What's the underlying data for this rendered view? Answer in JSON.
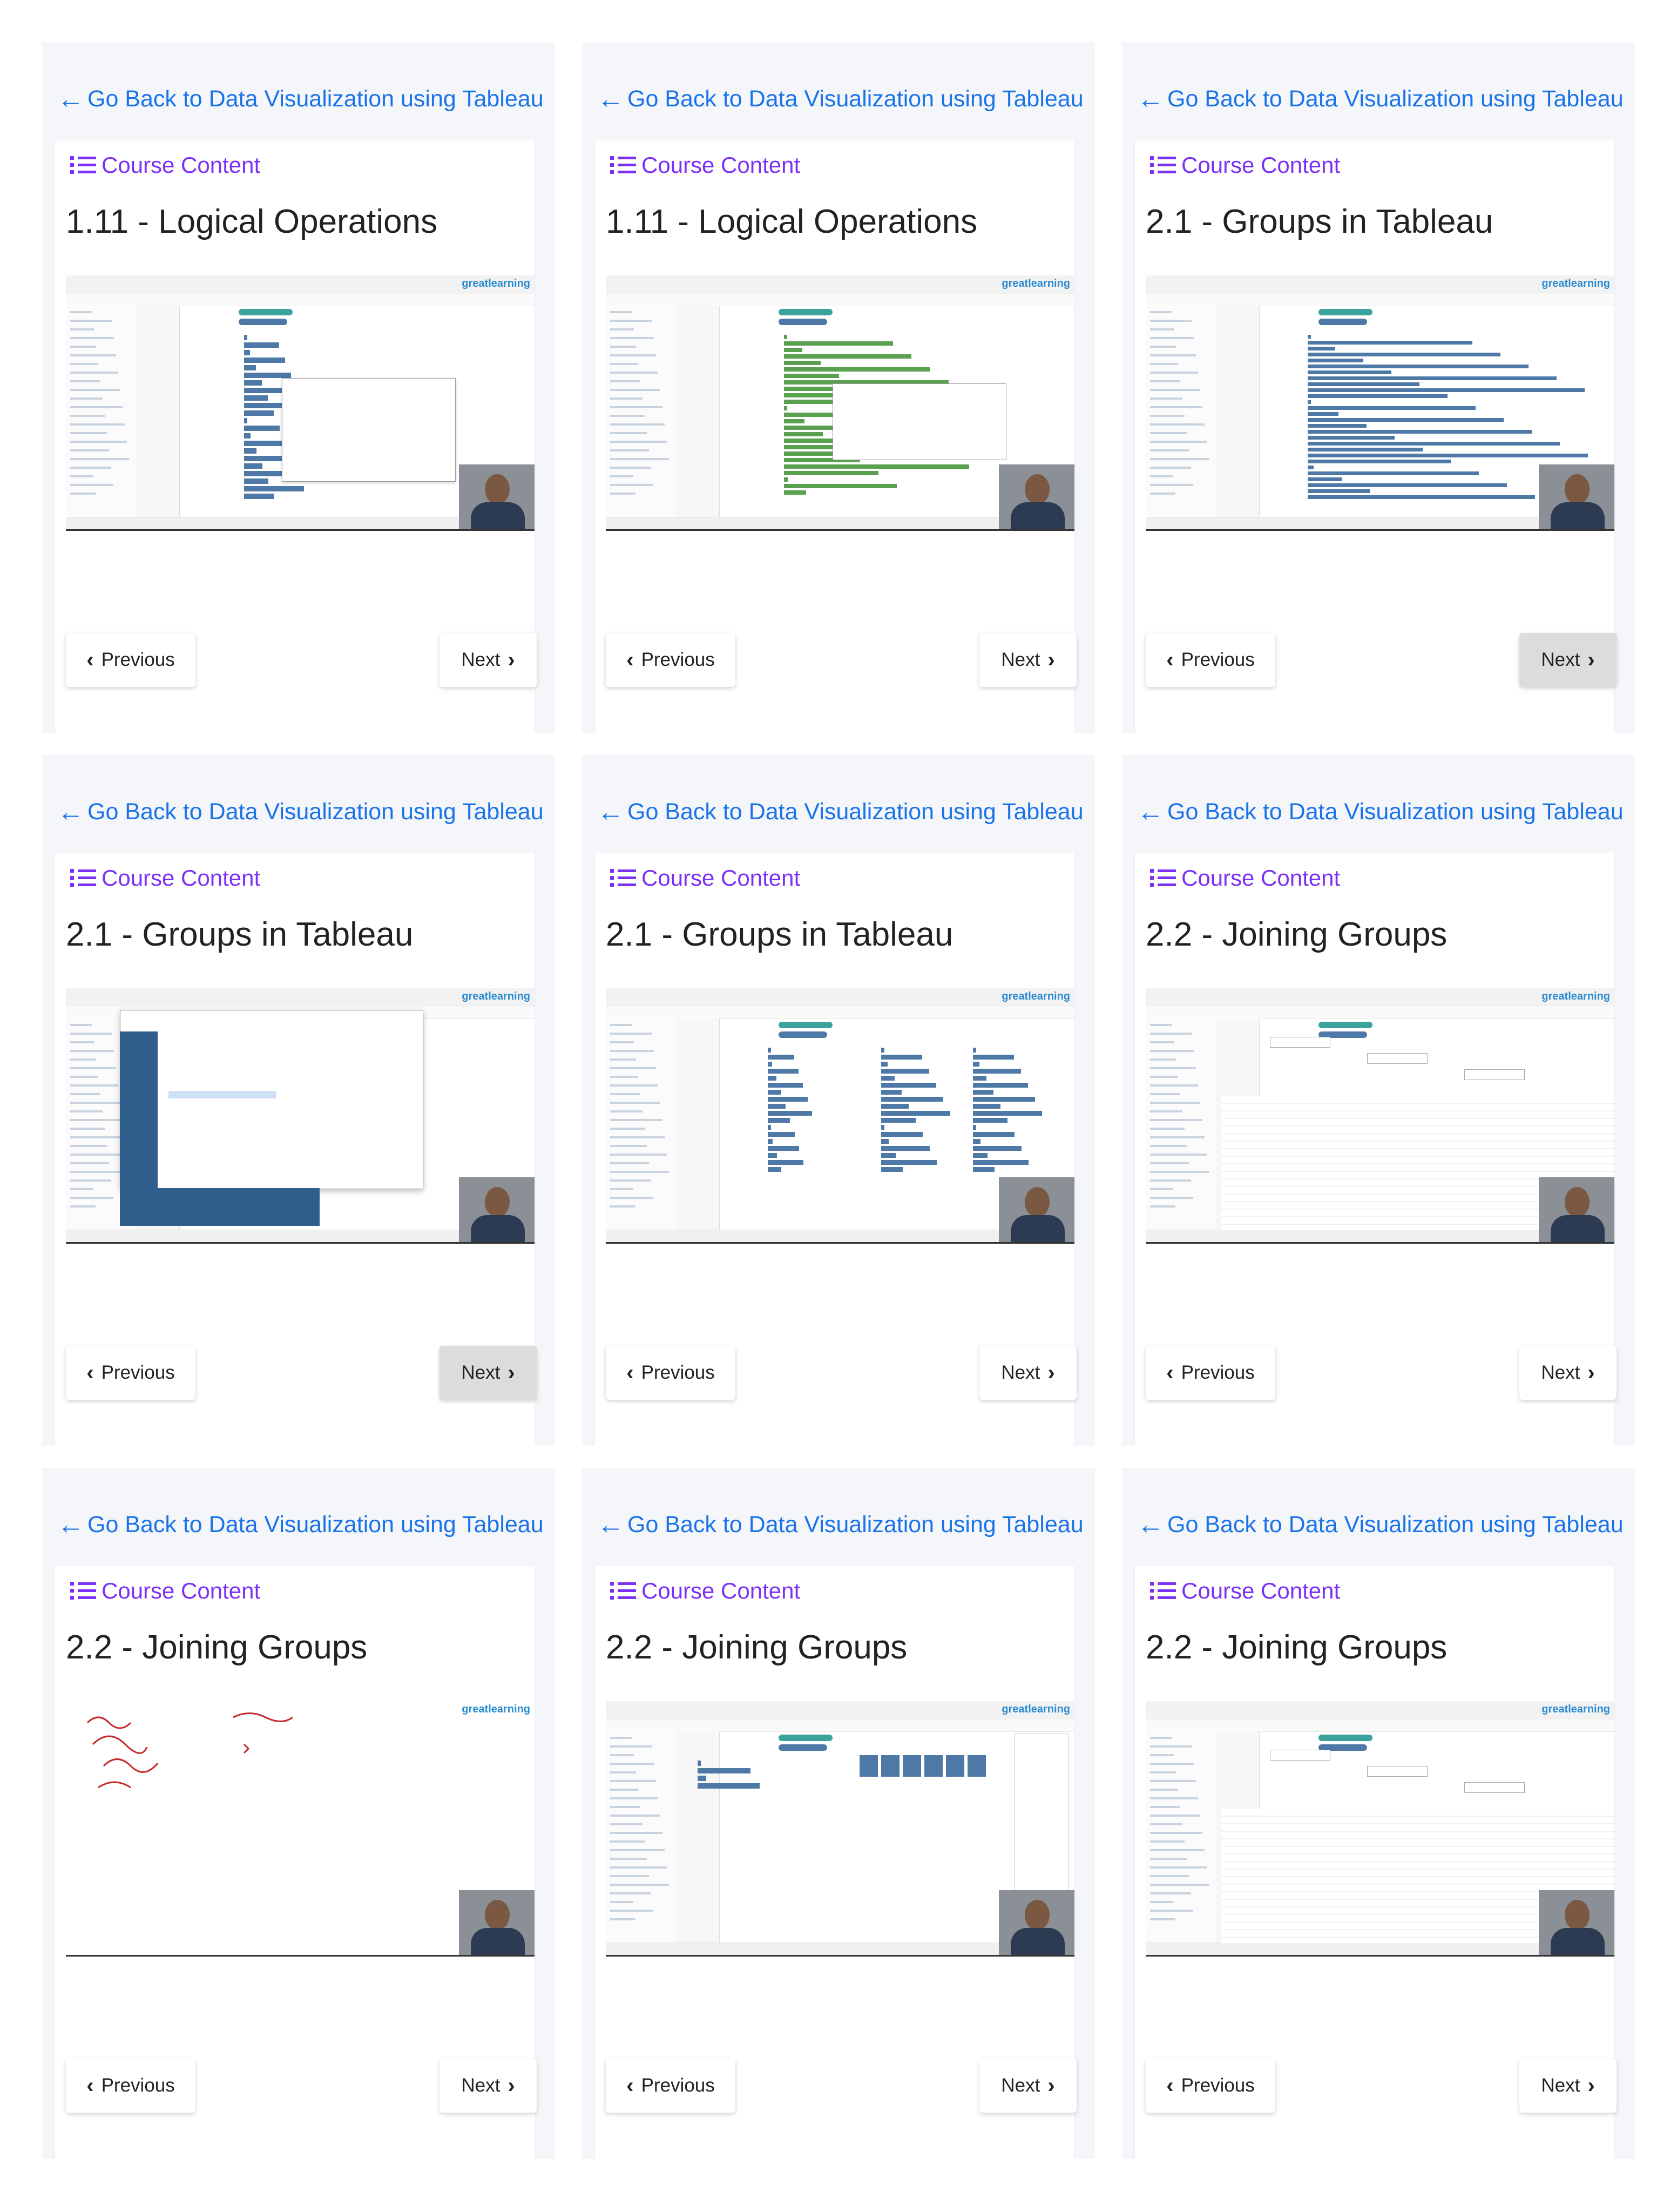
{
  "common": {
    "back_label": "Go Back to Data Visualization using Tableau",
    "course_content_label": "Course Content",
    "previous_label": "Previous",
    "next_label": "Next",
    "brand": "greatlearning"
  },
  "panels": [
    {
      "title": "1.11 - Logical Operations",
      "active_button": "none",
      "thumb": "bars-dialog"
    },
    {
      "title": "1.11 - Logical Operations",
      "active_button": "none",
      "thumb": "green-bars"
    },
    {
      "title": "2.1 - Groups in Tableau",
      "active_button": "next",
      "thumb": "blue-bars"
    },
    {
      "title": "2.1 - Groups in Tableau",
      "active_button": "next",
      "thumb": "file-dialog"
    },
    {
      "title": "2.1 - Groups in Tableau",
      "active_button": "none",
      "thumb": "multi-bars"
    },
    {
      "title": "2.2 - Joining Groups",
      "active_button": "none",
      "thumb": "data-source"
    },
    {
      "title": "2.2 - Joining Groups",
      "active_button": "none",
      "thumb": "whiteboard"
    },
    {
      "title": "2.2 - Joining Groups",
      "active_button": "none",
      "thumb": "small-bars"
    },
    {
      "title": "2.2 - Joining Groups",
      "active_button": "none",
      "thumb": "data-source"
    }
  ],
  "colors": {
    "link": "#1a73e8",
    "course_content": "#7b2ff7",
    "tableau_blue": "#4e79a7",
    "tableau_green": "#59a14f"
  }
}
